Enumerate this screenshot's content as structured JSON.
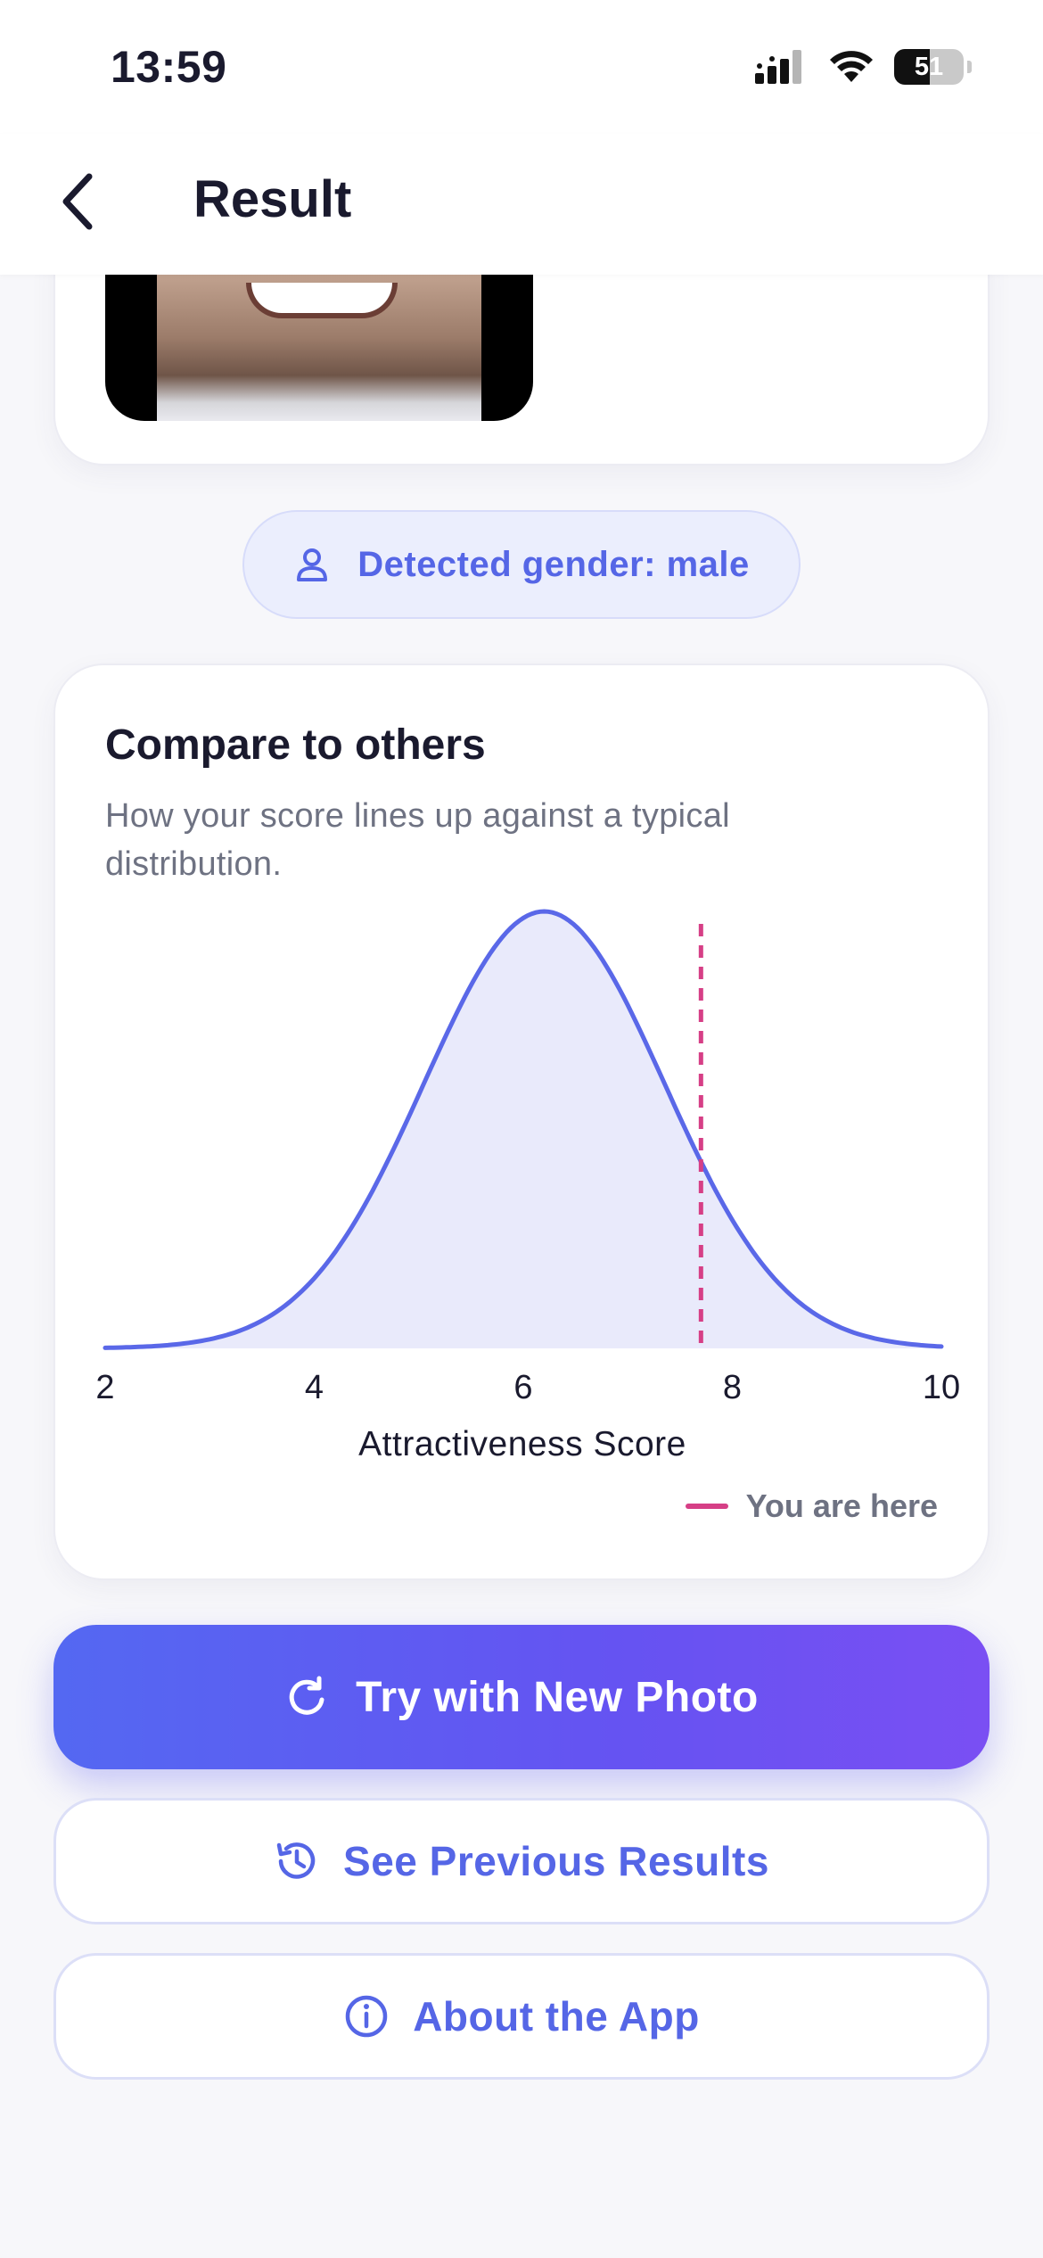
{
  "status_bar": {
    "time": "13:59",
    "battery": "51"
  },
  "header": {
    "title": "Result"
  },
  "gender": {
    "label": "Detected gender: male"
  },
  "compare": {
    "title": "Compare to others",
    "subtitle": "How your score lines up against a typical distribution.",
    "legend": "You are here"
  },
  "chart_data": {
    "type": "area",
    "xlabel": "Attractiveness Score",
    "xlim": [
      2,
      10
    ],
    "x_ticks": [
      "2",
      "4",
      "6",
      "8",
      "10"
    ],
    "distribution": {
      "shape": "normal",
      "mean": 6.2,
      "sd": 1.15
    },
    "user_score": 7.7,
    "colors": {
      "curve": "#5a68e8",
      "fill": "#e9eafb",
      "marker": "#d63f86"
    }
  },
  "buttons": {
    "primary": "Try with New Photo",
    "previous": "See Previous Results",
    "about": "About the App"
  },
  "colors": {
    "accent": "#5566e6",
    "gradient_start": "#5468f2",
    "gradient_end": "#7a4ff3"
  }
}
